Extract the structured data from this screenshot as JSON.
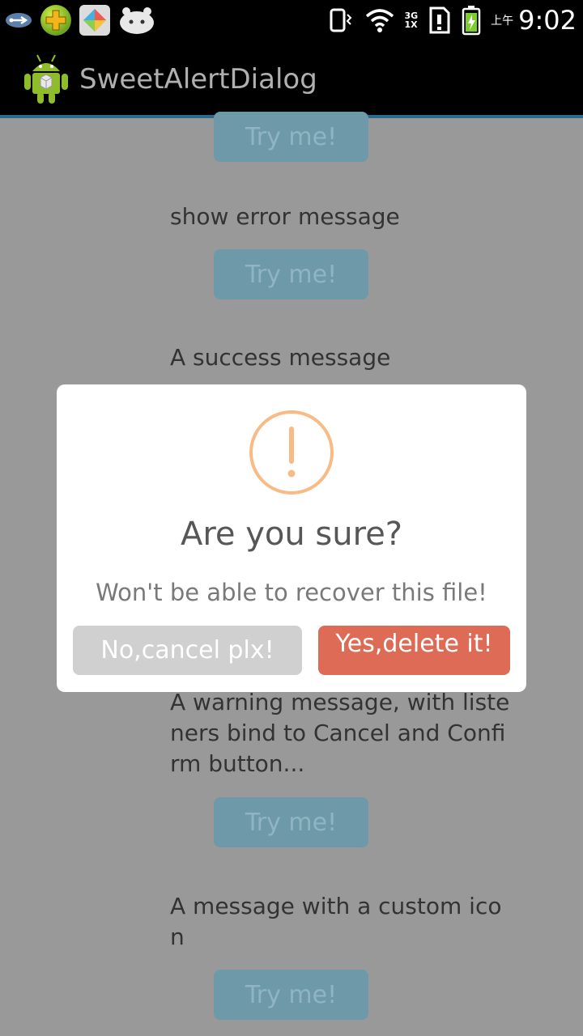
{
  "status_bar": {
    "network_top": "3G",
    "network_bottom": "1X",
    "ampm": "上午",
    "time": "9:02"
  },
  "action_bar": {
    "title": "SweetAlertDialog"
  },
  "list": {
    "try_label": "Try me!",
    "items": [
      {
        "text": "show error message"
      },
      {
        "text": "A success message"
      },
      {
        "text": "A warning message, with listeners bind to Cancel and Confirm button..."
      },
      {
        "text": "A message with a custom icon"
      }
    ]
  },
  "dialog": {
    "title": "Are you sure?",
    "message": "Won't be able to recover this file!",
    "cancel_label": "No,cancel plx!",
    "confirm_label": "Yes,delete it!",
    "colors": {
      "warning": "#f8bb86",
      "confirm": "#dd6b55",
      "cancel": "#d0d0d0"
    }
  }
}
